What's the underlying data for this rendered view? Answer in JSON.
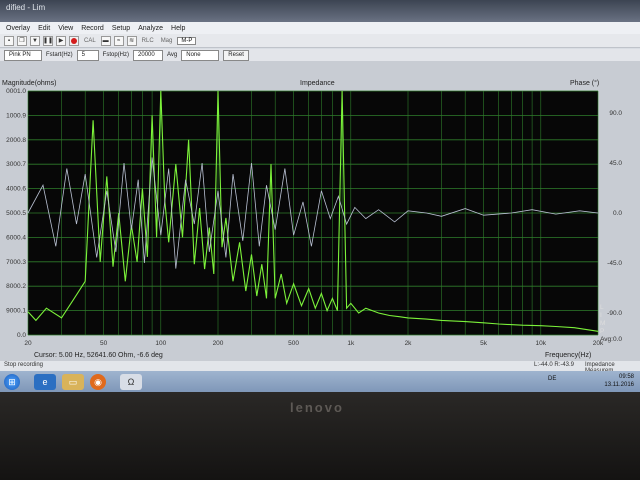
{
  "window": {
    "title": "dified - Lim"
  },
  "menu": [
    "Overlay",
    "Edit",
    "View",
    "Record",
    "Setup",
    "Analyze",
    "Help"
  ],
  "toolbar": {
    "labels": [
      "CAL",
      "RLC",
      "Mag",
      "M-P"
    ],
    "active": "M-P"
  },
  "options": {
    "noise_value": "Pink PN",
    "fstart_label": "Fstart(Hz)",
    "fstart_value": "5",
    "fstop_label": "Fstop(Hz)",
    "fstop_value": "20000",
    "avg_label": "Avg",
    "avg_value": "None",
    "reset_label": "Reset"
  },
  "chart_data": {
    "type": "line",
    "title": "Impedance",
    "ylabel": "Magnitude(ohms)",
    "y2label": "Phase (°)",
    "xlabel": "Frequency(Hz)",
    "xscale": "log",
    "xlim": [
      20,
      20000
    ],
    "y_tick_labels": [
      "0001.0",
      "1000.9",
      "2000.8",
      "3000.7",
      "4000.6",
      "5000.5",
      "6000.4",
      "7000.3",
      "8000.2",
      "9000.1",
      "0.0"
    ],
    "y2_tick_labels": [
      "90.0",
      "45.0",
      "0.0",
      "-45.0",
      "-90.0",
      "Avg:0.0"
    ],
    "x_tick_labels": [
      "20",
      "50",
      "100",
      "200",
      "500",
      "1k",
      "2k",
      "5k",
      "10k",
      "20k"
    ],
    "x_ticks": [
      20,
      50,
      100,
      200,
      500,
      1000,
      2000,
      5000,
      10000,
      20000
    ],
    "right_letters": [
      "L",
      "I",
      "M",
      "P"
    ],
    "series": [
      {
        "color": "#7cf23a",
        "x": [
          20,
          22,
          25,
          30,
          35,
          40,
          44,
          48,
          52,
          56,
          60,
          65,
          70,
          75,
          80,
          85,
          90,
          95,
          100,
          105,
          110,
          120,
          130,
          140,
          150,
          160,
          170,
          180,
          190,
          200,
          210,
          220,
          240,
          260,
          280,
          300,
          320,
          340,
          360,
          380,
          400,
          430,
          460,
          500,
          550,
          600,
          650,
          700,
          750,
          800,
          850,
          900,
          950,
          1000,
          1100,
          1200,
          1400,
          1600,
          1800,
          2000,
          2500,
          3000,
          4000,
          5000,
          6000,
          8000,
          10000,
          12000,
          15000,
          20000
        ],
        "y": [
          950,
          600,
          1100,
          700,
          1500,
          2200,
          8800,
          3000,
          6500,
          2800,
          5000,
          2200,
          4500,
          3000,
          6000,
          3200,
          9000,
          4000,
          10000,
          5500,
          3800,
          7000,
          4000,
          8000,
          2900,
          5200,
          2700,
          4400,
          2500,
          10000,
          3600,
          4800,
          2200,
          3800,
          1800,
          3300,
          1600,
          2900,
          1500,
          7000,
          1500,
          2500,
          1300,
          2100,
          1200,
          1900,
          1100,
          1700,
          1000,
          1500,
          1000,
          10000,
          1100,
          1300,
          900,
          1100,
          900,
          800,
          750,
          700,
          650,
          600,
          550,
          500,
          450,
          400,
          380,
          350,
          300,
          150
        ]
      },
      {
        "color": "#b9c1d3",
        "x": [
          20,
          24,
          28,
          32,
          36,
          40,
          46,
          52,
          58,
          64,
          70,
          76,
          82,
          90,
          100,
          110,
          120,
          135,
          150,
          165,
          180,
          200,
          220,
          240,
          270,
          300,
          330,
          360,
          400,
          450,
          500,
          560,
          620,
          700,
          780,
          860,
          950,
          1050,
          1200,
          1400,
          1700,
          2000,
          2500,
          3000,
          4000,
          5000,
          7000,
          9000,
          12000,
          16000,
          20000
        ],
        "y": [
          0,
          25,
          -30,
          40,
          -10,
          35,
          -40,
          20,
          -35,
          45,
          -15,
          30,
          -45,
          50,
          -20,
          40,
          -50,
          30,
          -10,
          45,
          -35,
          20,
          -40,
          35,
          -25,
          45,
          -30,
          25,
          -15,
          40,
          -20,
          10,
          -30,
          20,
          -5,
          15,
          -10,
          5,
          -5,
          3,
          -8,
          2,
          0,
          -3,
          4,
          -2,
          0,
          3,
          -1,
          2,
          0
        ]
      }
    ]
  },
  "cursor_text": "Cursor: 5.00 Hz, 52641.60 Ohm, -6.6 deg",
  "status": {
    "left": "Stop recording",
    "right": "L:-44.0  R:-43.9",
    "mode": "Impedance Measurem"
  },
  "taskbar": {
    "lang": "DE",
    "time": "09:58",
    "date": "13.11.2016"
  },
  "laptop_brand": "lenovo"
}
